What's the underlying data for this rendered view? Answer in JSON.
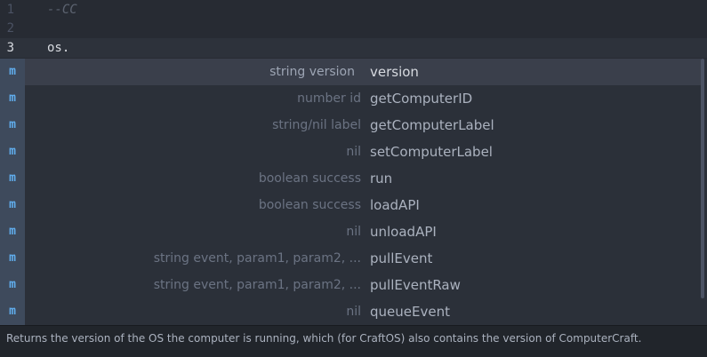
{
  "editor": {
    "lines": [
      {
        "number": "1",
        "text": "--CC"
      },
      {
        "number": "2",
        "text": ""
      },
      {
        "number": "3",
        "text": "os."
      }
    ]
  },
  "autocomplete": {
    "items": [
      {
        "kind": "m",
        "left_label": "string version",
        "name": "version",
        "selected": true
      },
      {
        "kind": "m",
        "left_label": "number id",
        "name": "getComputerID",
        "selected": false
      },
      {
        "kind": "m",
        "left_label": "string/nil label",
        "name": "getComputerLabel",
        "selected": false
      },
      {
        "kind": "m",
        "left_label": "nil",
        "name": "setComputerLabel",
        "selected": false
      },
      {
        "kind": "m",
        "left_label": "boolean success",
        "name": "run",
        "selected": false
      },
      {
        "kind": "m",
        "left_label": "boolean success",
        "name": "loadAPI",
        "selected": false
      },
      {
        "kind": "m",
        "left_label": "nil",
        "name": "unloadAPI",
        "selected": false
      },
      {
        "kind": "m",
        "left_label": "string event, param1, param2, ...",
        "name": "pullEvent",
        "selected": false
      },
      {
        "kind": "m",
        "left_label": "string event, param1, param2, ...",
        "name": "pullEventRaw",
        "selected": false
      },
      {
        "kind": "m",
        "left_label": "nil",
        "name": "queueEvent",
        "selected": false
      }
    ],
    "description": "Returns the version of the OS the computer is running, which (for CraftOS) also contains the version of ComputerCraft."
  },
  "colors": {
    "background": "#272b33",
    "badge_text": "#61afef",
    "selected_row": "#3a3f4b"
  }
}
